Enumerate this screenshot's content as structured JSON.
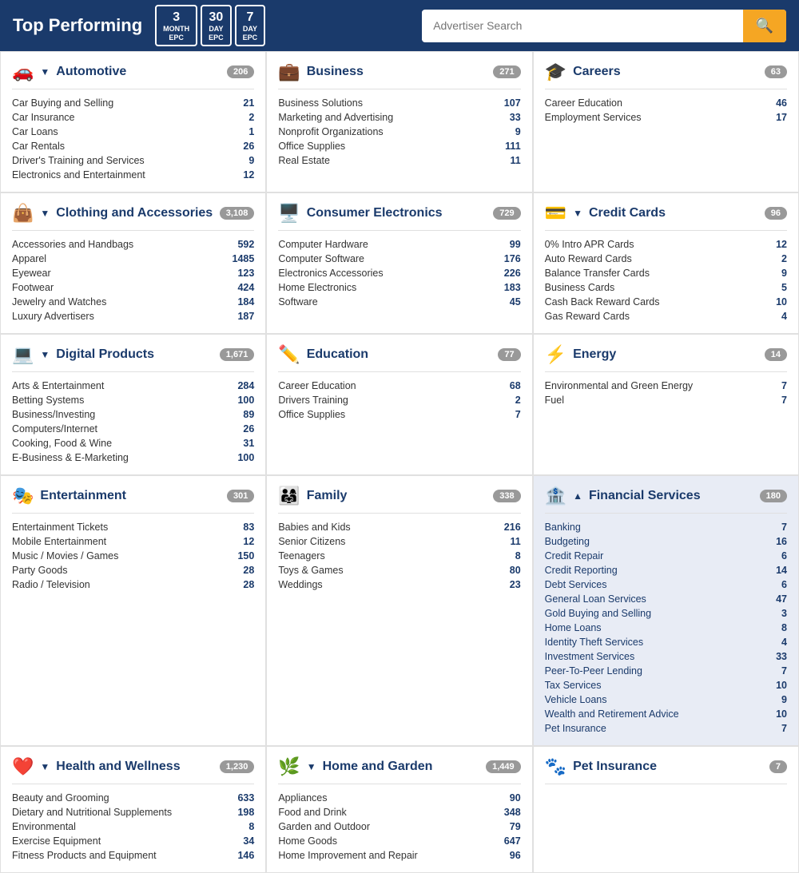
{
  "header": {
    "title": "Top Performing",
    "epc_buttons": [
      {
        "big": "3",
        "small": "MONTH EPC"
      },
      {
        "big": "30",
        "small": "DAY EPC"
      },
      {
        "big": "7",
        "small": "DAY EPC"
      }
    ],
    "search_placeholder": "Advertiser Search",
    "search_icon": "🔍"
  },
  "categories": [
    {
      "id": "automotive",
      "icon": "🚗",
      "title": "Automotive",
      "toggle": "▼",
      "count": "206",
      "items": [
        {
          "name": "Car Buying and Selling",
          "count": "21"
        },
        {
          "name": "Car Insurance",
          "count": "2"
        },
        {
          "name": "Car Loans",
          "count": "1"
        },
        {
          "name": "Car Rentals",
          "count": "26"
        },
        {
          "name": "Driver's Training and Services",
          "count": "9"
        },
        {
          "name": "Electronics and Entertainment",
          "count": "12"
        }
      ]
    },
    {
      "id": "business",
      "icon": "💼",
      "title": "Business",
      "toggle": "",
      "count": "271",
      "items": [
        {
          "name": "Business Solutions",
          "count": "107"
        },
        {
          "name": "Marketing and Advertising",
          "count": "33"
        },
        {
          "name": "Nonprofit Organizations",
          "count": "9"
        },
        {
          "name": "Office Supplies",
          "count": "111"
        },
        {
          "name": "Real Estate",
          "count": "11"
        }
      ]
    },
    {
      "id": "careers",
      "icon": "🎓",
      "title": "Careers",
      "toggle": "",
      "count": "63",
      "items": [
        {
          "name": "Career Education",
          "count": "46"
        },
        {
          "name": "Employment Services",
          "count": "17"
        }
      ]
    },
    {
      "id": "clothing",
      "icon": "👜",
      "title": "Clothing and Accessories",
      "toggle": "▼",
      "count": "3,108",
      "items": [
        {
          "name": "Accessories and Handbags",
          "count": "592"
        },
        {
          "name": "Apparel",
          "count": "1485"
        },
        {
          "name": "Eyewear",
          "count": "123"
        },
        {
          "name": "Footwear",
          "count": "424"
        },
        {
          "name": "Jewelry and Watches",
          "count": "184"
        },
        {
          "name": "Luxury Advertisers",
          "count": "187"
        }
      ]
    },
    {
      "id": "consumer-electronics",
      "icon": "🖥️",
      "title": "Consumer Electronics",
      "toggle": "",
      "count": "729",
      "items": [
        {
          "name": "Computer Hardware",
          "count": "99"
        },
        {
          "name": "Computer Software",
          "count": "176"
        },
        {
          "name": "Electronics Accessories",
          "count": "226"
        },
        {
          "name": "Home Electronics",
          "count": "183"
        },
        {
          "name": "Software",
          "count": "45"
        }
      ]
    },
    {
      "id": "credit-cards",
      "icon": "💳",
      "title": "Credit Cards",
      "toggle": "▼",
      "count": "96",
      "items": [
        {
          "name": "0% Intro APR Cards",
          "count": "12"
        },
        {
          "name": "Auto Reward Cards",
          "count": "2"
        },
        {
          "name": "Balance Transfer Cards",
          "count": "9"
        },
        {
          "name": "Business Cards",
          "count": "5"
        },
        {
          "name": "Cash Back Reward Cards",
          "count": "10"
        },
        {
          "name": "Gas Reward Cards",
          "count": "4"
        }
      ]
    },
    {
      "id": "digital-products",
      "icon": "💻",
      "title": "Digital Products",
      "toggle": "▼",
      "count": "1,671",
      "items": [
        {
          "name": "Arts & Entertainment",
          "count": "284"
        },
        {
          "name": "Betting Systems",
          "count": "100"
        },
        {
          "name": "Business/Investing",
          "count": "89"
        },
        {
          "name": "Computers/Internet",
          "count": "26"
        },
        {
          "name": "Cooking, Food & Wine",
          "count": "31"
        },
        {
          "name": "E-Business & E-Marketing",
          "count": "100"
        }
      ]
    },
    {
      "id": "education",
      "icon": "✏️",
      "title": "Education",
      "toggle": "",
      "count": "77",
      "items": [
        {
          "name": "Career Education",
          "count": "68"
        },
        {
          "name": "Drivers Training",
          "count": "2"
        },
        {
          "name": "Office Supplies",
          "count": "7"
        }
      ]
    },
    {
      "id": "energy",
      "icon": "⚡",
      "title": "Energy",
      "toggle": "",
      "count": "14",
      "items": [
        {
          "name": "Environmental and Green Energy",
          "count": "7"
        },
        {
          "name": "Fuel",
          "count": "7"
        }
      ]
    },
    {
      "id": "entertainment",
      "icon": "🎭",
      "title": "Entertainment",
      "toggle": "",
      "count": "301",
      "items": [
        {
          "name": "Entertainment Tickets",
          "count": "83"
        },
        {
          "name": "Mobile Entertainment",
          "count": "12"
        },
        {
          "name": "Music / Movies / Games",
          "count": "150"
        },
        {
          "name": "Party Goods",
          "count": "28"
        },
        {
          "name": "Radio / Television",
          "count": "28"
        }
      ]
    },
    {
      "id": "family",
      "icon": "👨‍👩‍👧",
      "title": "Family",
      "toggle": "",
      "count": "338",
      "items": [
        {
          "name": "Babies and Kids",
          "count": "216"
        },
        {
          "name": "Senior Citizens",
          "count": "11"
        },
        {
          "name": "Teenagers",
          "count": "8"
        },
        {
          "name": "Toys & Games",
          "count": "80"
        },
        {
          "name": "Weddings",
          "count": "23"
        }
      ]
    },
    {
      "id": "financial-services",
      "icon": "🏦",
      "title": "Financial Services",
      "toggle": "▲",
      "count": "180",
      "highlighted": true,
      "items": [
        {
          "name": "Banking",
          "count": "7"
        },
        {
          "name": "Budgeting",
          "count": "16"
        },
        {
          "name": "Credit Repair",
          "count": "6"
        },
        {
          "name": "Credit Reporting",
          "count": "14"
        },
        {
          "name": "Debt Services",
          "count": "6"
        },
        {
          "name": "General Loan Services",
          "count": "47"
        },
        {
          "name": "Gold Buying and Selling",
          "count": "3"
        },
        {
          "name": "Home Loans",
          "count": "8"
        },
        {
          "name": "Identity Theft Services",
          "count": "4"
        },
        {
          "name": "Investment Services",
          "count": "33"
        },
        {
          "name": "Peer-To-Peer Lending",
          "count": "7"
        },
        {
          "name": "Tax Services",
          "count": "10"
        },
        {
          "name": "Vehicle Loans",
          "count": "9"
        },
        {
          "name": "Wealth and Retirement Advice",
          "count": "10"
        }
      ]
    },
    {
      "id": "health-wellness",
      "icon": "❤️",
      "title": "Health and Wellness",
      "toggle": "▼",
      "count": "1,230",
      "items": [
        {
          "name": "Beauty and Grooming",
          "count": "633"
        },
        {
          "name": "Dietary and Nutritional Supplements",
          "count": "198"
        },
        {
          "name": "Environmental",
          "count": "8"
        },
        {
          "name": "Exercise Equipment",
          "count": "34"
        },
        {
          "name": "Fitness Products and Equipment",
          "count": "146"
        }
      ]
    },
    {
      "id": "home-garden",
      "icon": "🌿",
      "title": "Home and Garden",
      "toggle": "▼",
      "count": "1,449",
      "items": [
        {
          "name": "Appliances",
          "count": "90"
        },
        {
          "name": "Food and Drink",
          "count": "348"
        },
        {
          "name": "Garden and Outdoor",
          "count": "79"
        },
        {
          "name": "Home Goods",
          "count": "647"
        },
        {
          "name": "Home Improvement and Repair",
          "count": "96"
        }
      ]
    },
    {
      "id": "pet-insurance",
      "icon": "🐾",
      "title": "Pet Insurance",
      "toggle": "",
      "count": "7",
      "items": []
    }
  ]
}
